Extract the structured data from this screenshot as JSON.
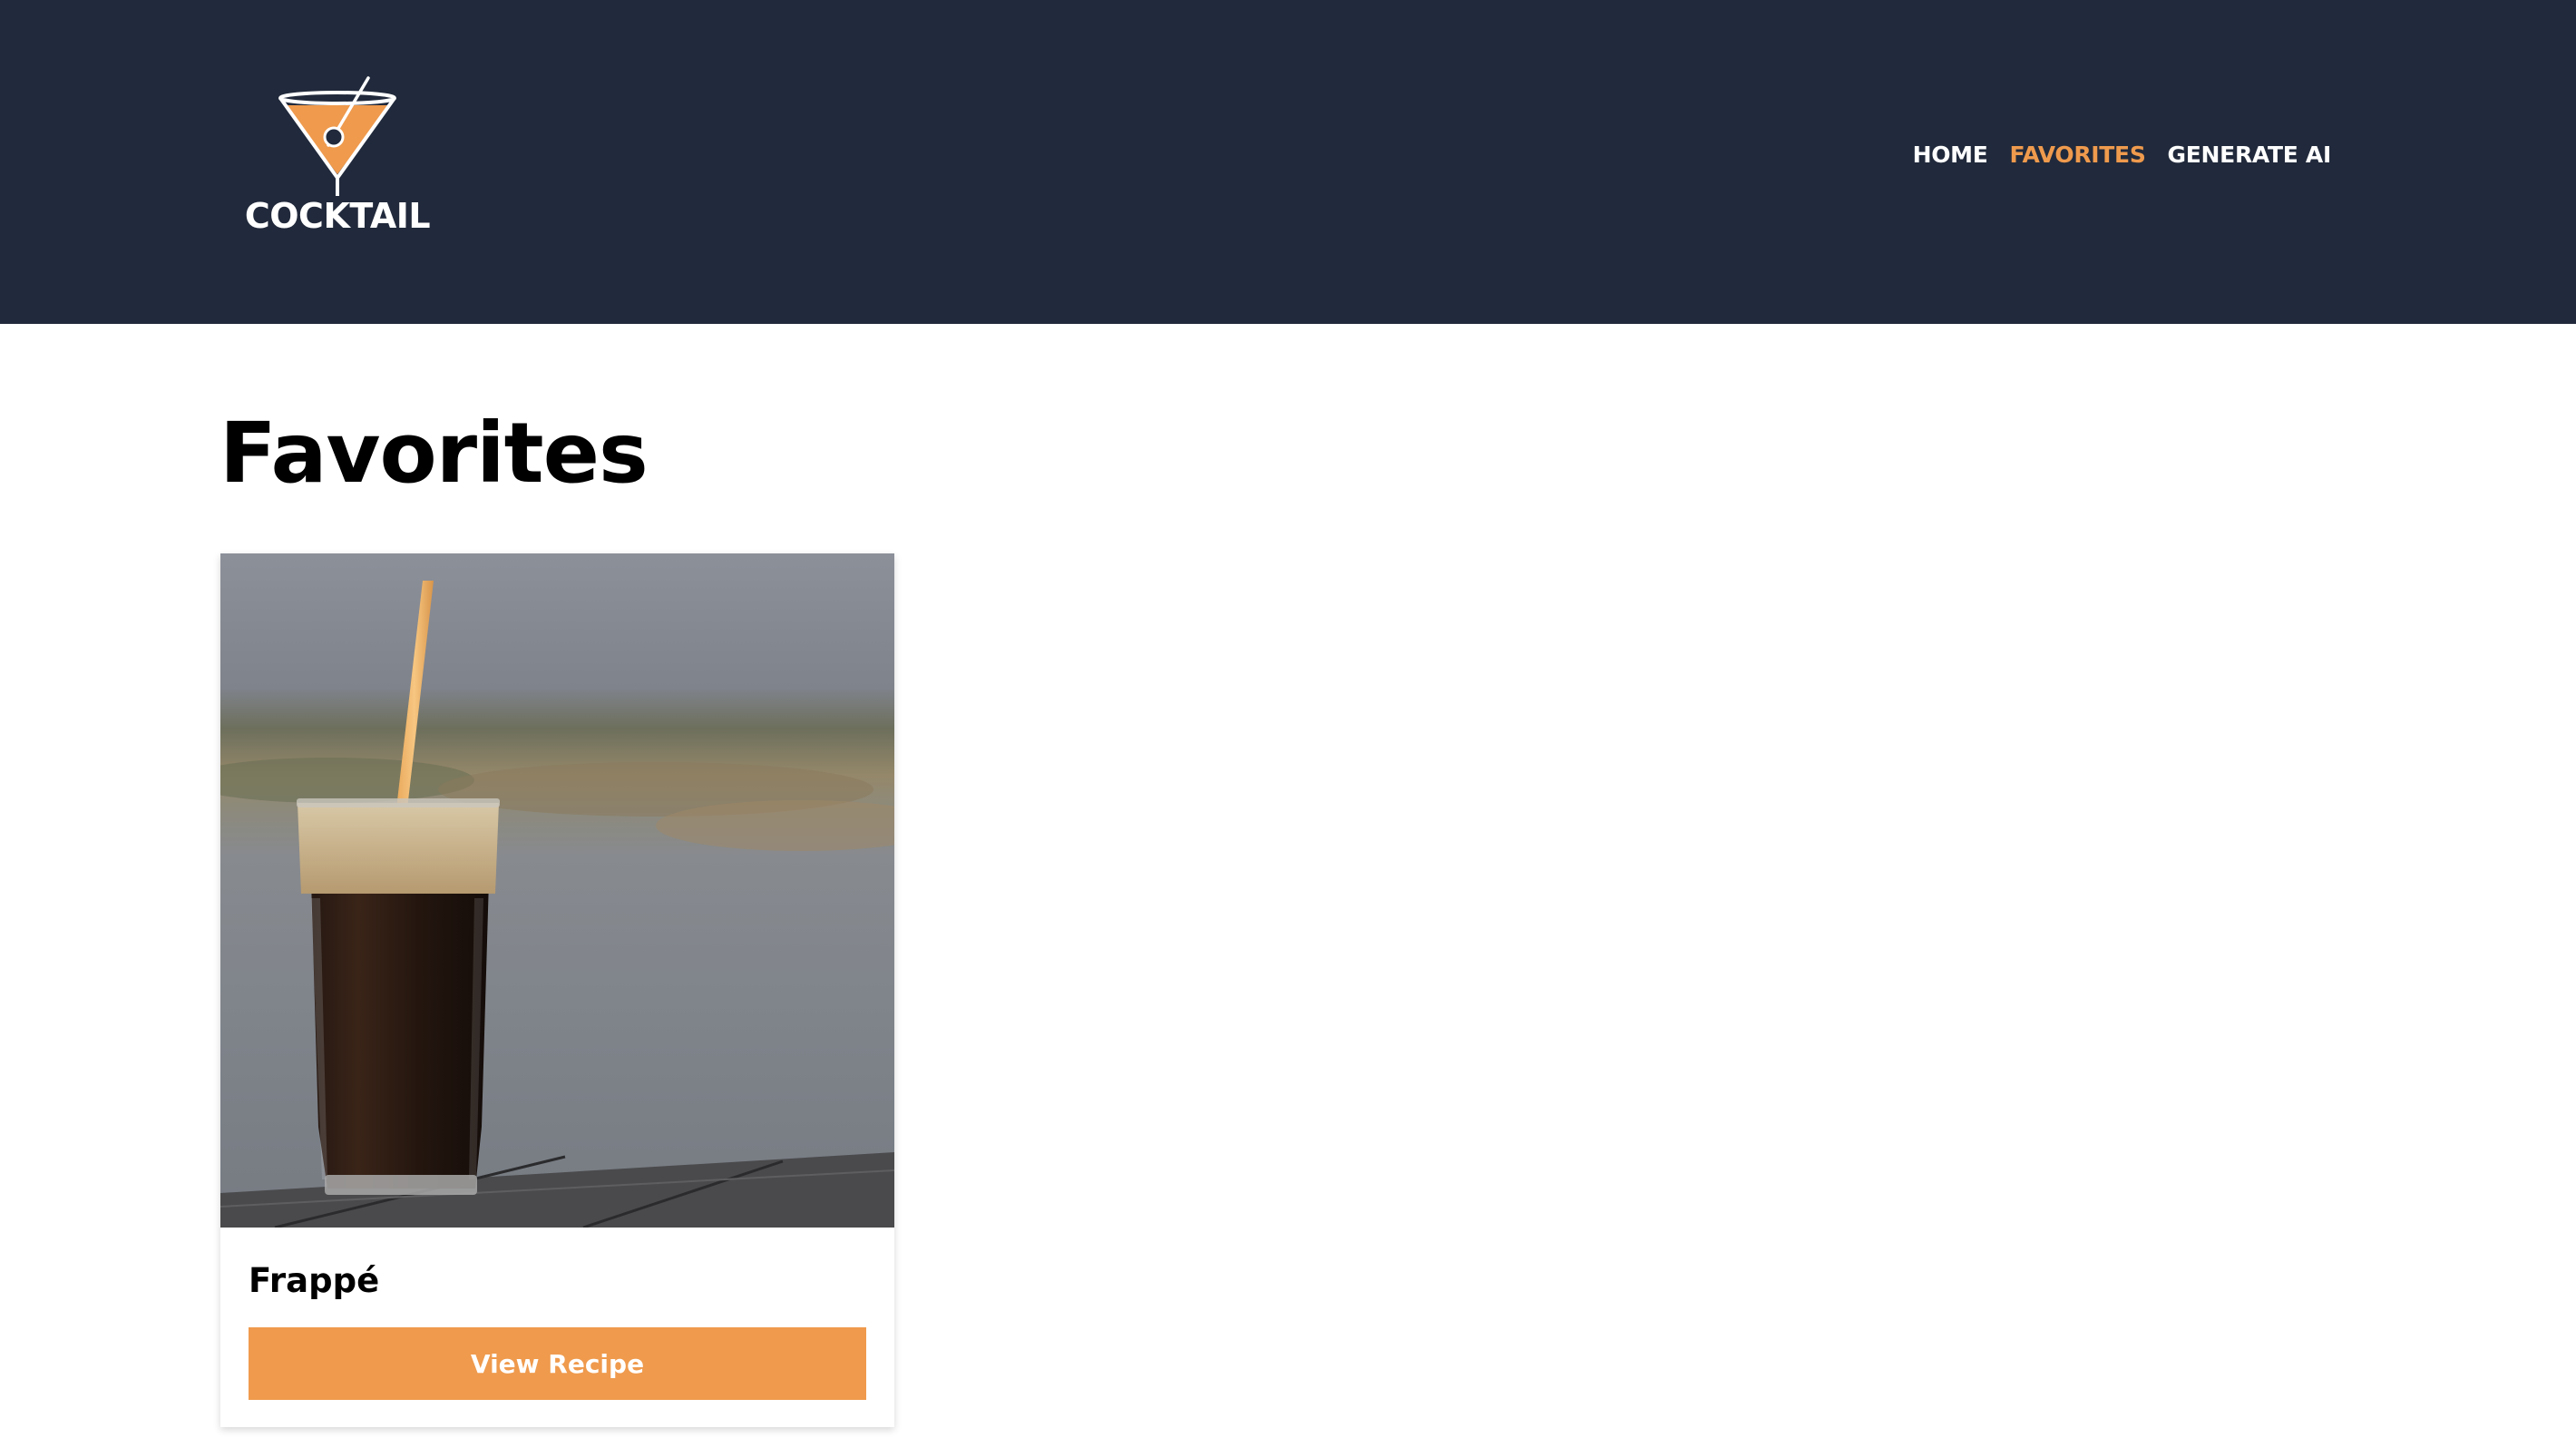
{
  "brand": {
    "name": "COCKTAIL",
    "logo_icon": "martini-glass-icon",
    "accent_color": "#ef9a4d",
    "header_color": "#212a3c"
  },
  "nav": {
    "items": [
      {
        "label": "HOME",
        "active": false
      },
      {
        "label": "FAVORITES",
        "active": true
      },
      {
        "label": "GENERATE AI",
        "active": false
      }
    ]
  },
  "main": {
    "title": "Favorites",
    "favorites": [
      {
        "name": "Frappé",
        "image": "frappe-drink-photo",
        "button_label": "View Recipe"
      }
    ]
  }
}
